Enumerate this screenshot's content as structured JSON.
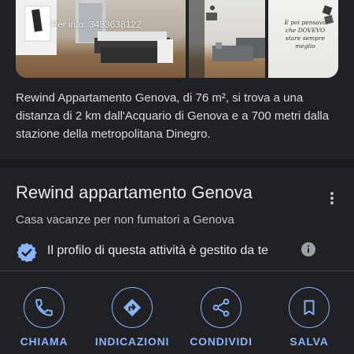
{
  "photos": {
    "watermark": "Per info: 3483638122",
    "wall_quote": "E poi pensavo che DOVEVO stare sempre meglio"
  },
  "description": "Rewind Appartamento Genova, di 76 m², si trova a una distanza di 2 km dall'Acquario di Genova e a 700 metri dalla stazione della metropolitana Dinegro.",
  "place": {
    "title": "Rewind appartamento Genova",
    "category": "Casa vacanze per non fumatori a Genova",
    "verified_text": "Il profilo di questa attività è gestito da te"
  },
  "actions": [
    {
      "label": "CHIAMA",
      "icon": "phone-icon"
    },
    {
      "label": "INDICAZIONI",
      "icon": "directions-icon"
    },
    {
      "label": "CONDIVIDI",
      "icon": "share-icon"
    },
    {
      "label": "SALVA",
      "icon": "bookmark-icon"
    }
  ],
  "colors": {
    "background": "#202124",
    "accent": "#8ab4f8",
    "text_primary": "#e8eaed",
    "text_secondary": "#bdc1c6"
  }
}
